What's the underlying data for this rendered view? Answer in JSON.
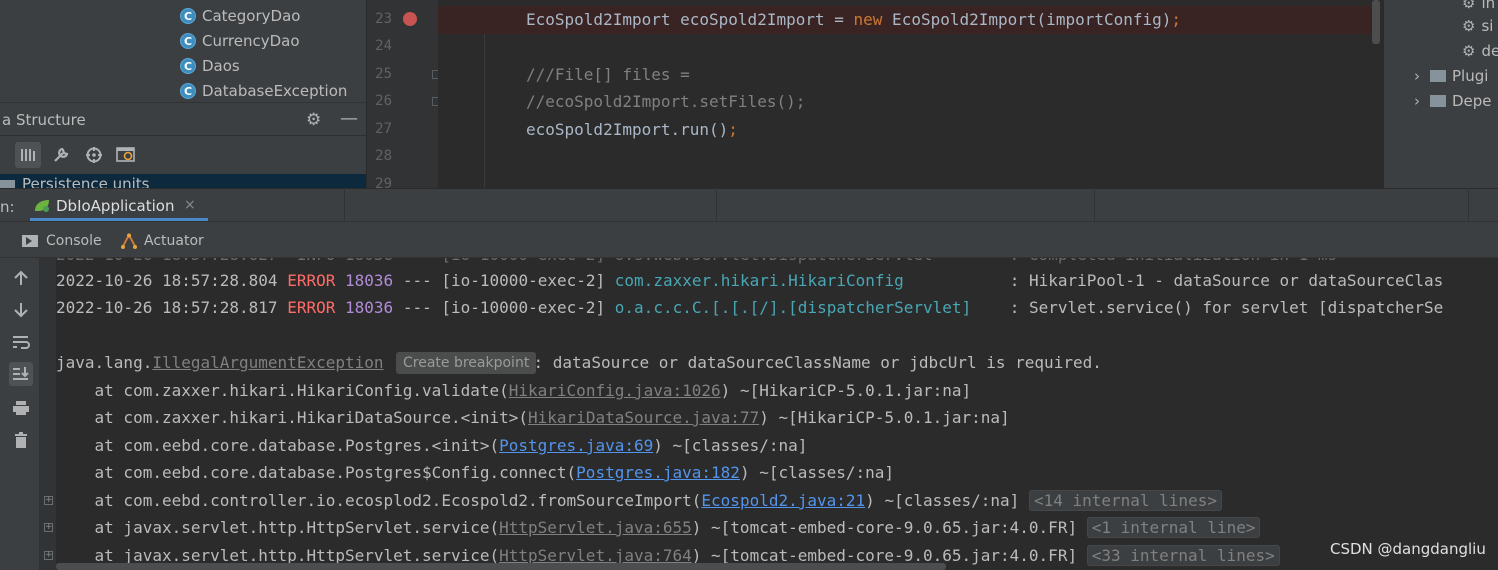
{
  "project_tree": {
    "items": [
      {
        "label": "CategoryDao",
        "icon": "class-icon"
      },
      {
        "label": "CurrencyDao",
        "icon": "class-icon"
      },
      {
        "label": "Daos",
        "icon": "class-icon"
      },
      {
        "label": "DatabaseException",
        "icon": "class-icon"
      }
    ]
  },
  "structure_panel": {
    "title": "a Structure",
    "persistence_units": "Persistence units"
  },
  "editor": {
    "line_numbers": [
      "23",
      "24",
      "25",
      "26",
      "27",
      "28",
      "29"
    ],
    "lines": [
      {
        "pre": "EcoSpold2Import ecoSpold2Import = ",
        "kw": "new",
        "post": " EcoSpold2Import(importConfig)",
        "end": ";"
      },
      {
        "comment": "///File[] files ="
      },
      {
        "comment": "//ecoSpold2Import.setFiles();"
      },
      {
        "pre": "ecoSpold2Import.run()",
        "end": ";"
      }
    ],
    "breakpoint_color": "#c75450"
  },
  "right_panel": {
    "items": [
      "in",
      "si",
      "de",
      "Plugi",
      "Depe"
    ]
  },
  "run_window": {
    "label": "n:",
    "tab_label": "DbIoApplication",
    "close_glyph": "×",
    "subtabs": {
      "console": "Console",
      "actuator": "Actuator"
    }
  },
  "console": {
    "log_lines": [
      {
        "ts": "2022-10-26 18:57:28.804",
        "level": "ERROR",
        "pid": "18036",
        "sep": "---",
        "thread": "[io-10000-exec-2]",
        "logger": "com.zaxxer.hikari.HikariConfig          ",
        "msg": ": HikariPool-1 - dataSource or dataSourceClas"
      },
      {
        "ts": "2022-10-26 18:57:28.817",
        "level": "ERROR",
        "pid": "18036",
        "sep": "---",
        "thread": "[io-10000-exec-2]",
        "logger": "o.a.c.c.C.[.[.[/].[dispatcherServlet]   ",
        "msg": ": Servlet.service() for servlet [dispatcherSe"
      }
    ],
    "exception": {
      "pkg": "java.lang.",
      "cls": "IllegalArgumentException",
      "msg": ": dataSource or dataSourceClassName or jdbcUrl is required."
    },
    "tooltip": "Create breakpoint",
    "stack": [
      {
        "pre": "    at com.zaxxer.hikari.HikariConfig.validate(",
        "link": "HikariConfig.java:1026",
        "lib": false,
        "post": ") ~[HikariCP-5.0.1.jar:na]",
        "pill": ""
      },
      {
        "pre": "    at com.zaxxer.hikari.HikariDataSource.<init>(",
        "link": "HikariDataSource.java:77",
        "lib": false,
        "post": ") ~[HikariCP-5.0.1.jar:na]",
        "pill": ""
      },
      {
        "pre": "    at com.eebd.core.database.Postgres.<init>(",
        "link": "Postgres.java:69",
        "lib": true,
        "post": ") ~[classes/:na]",
        "pill": ""
      },
      {
        "pre": "    at com.eebd.core.database.Postgres$Config.connect(",
        "link": "Postgres.java:182",
        "lib": true,
        "post": ") ~[classes/:na]",
        "pill": ""
      },
      {
        "pre": "    at com.eebd.controller.io.ecosplod2.Ecospold2.fromSourceImport(",
        "link": "Ecospold2.java:21",
        "lib": true,
        "post": ") ~[classes/:na] ",
        "pill": "<14 internal lines>"
      },
      {
        "pre": "    at javax.servlet.http.HttpServlet.service(",
        "link": "HttpServlet.java:655",
        "lib": false,
        "post": ") ~[tomcat-embed-core-9.0.65.jar:4.0.FR] ",
        "pill": "<1 internal line>"
      },
      {
        "pre": "    at javax.servlet.http.HttpServlet.service(",
        "link": "HttpServlet.java:764",
        "lib": false,
        "post": ") ~[tomcat-embed-core-9.0.65.jar:4.0.FR] ",
        "pill": "<33 internal lines>"
      }
    ]
  },
  "watermark": "CSDN @dangdangliu"
}
